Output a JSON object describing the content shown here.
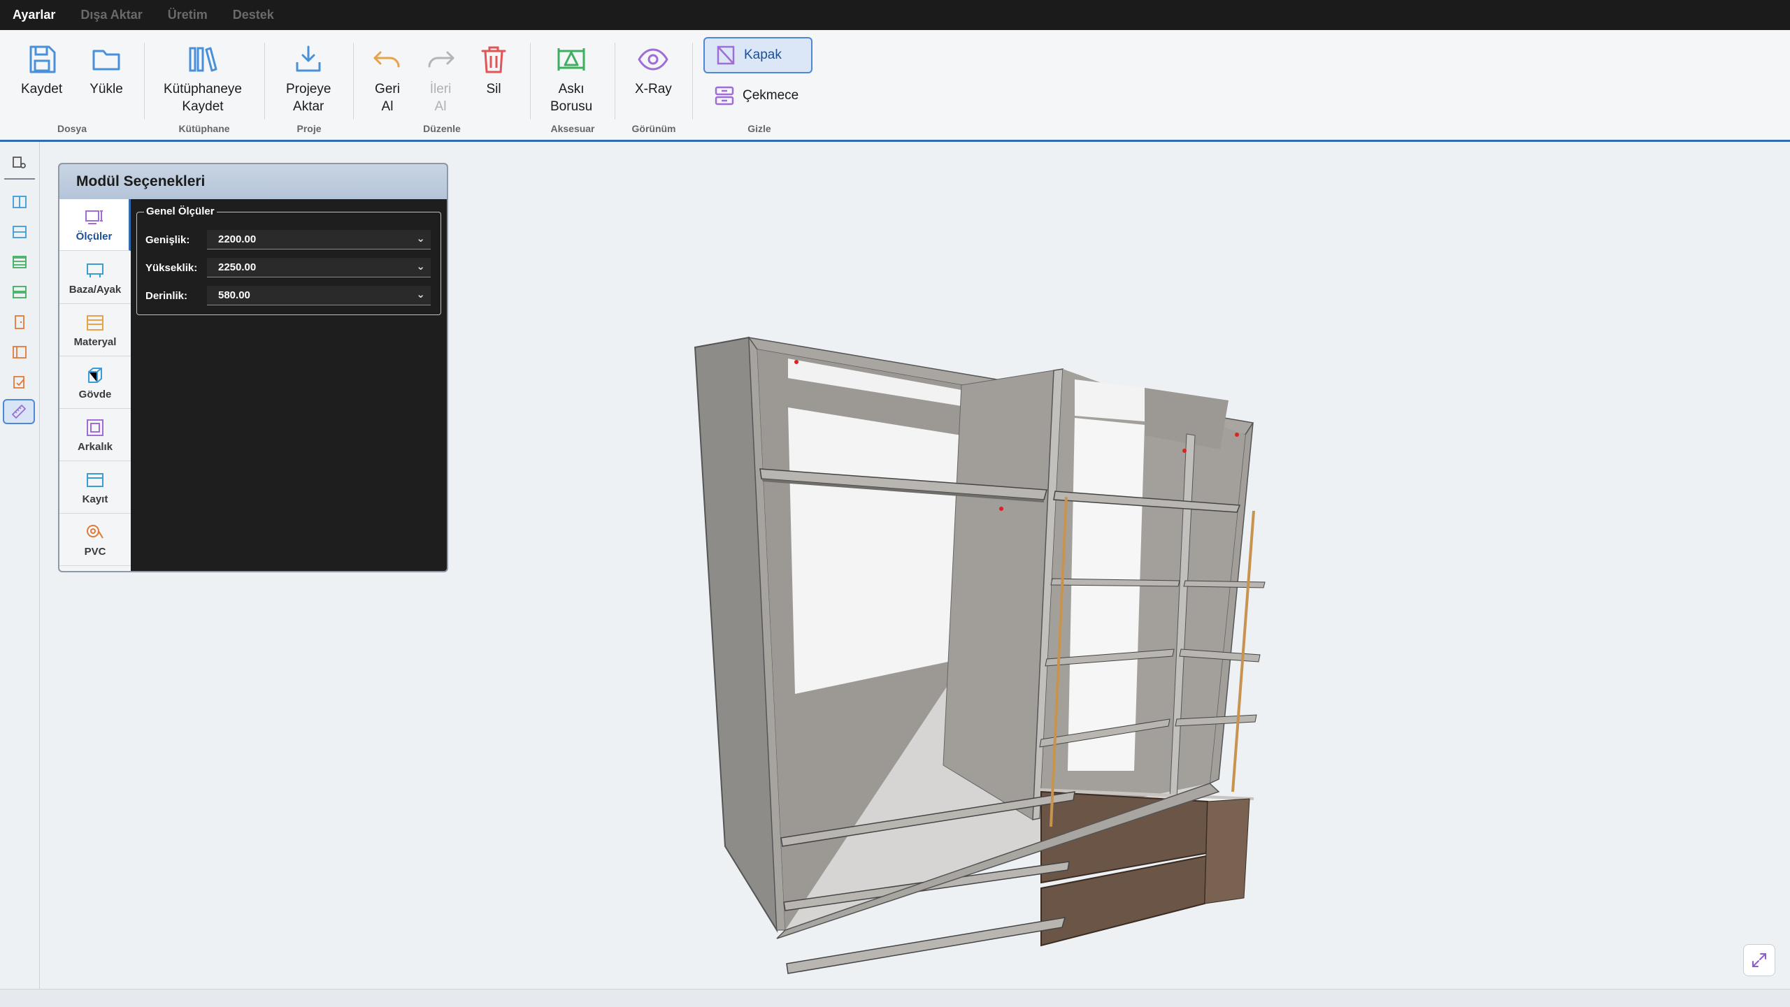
{
  "menu": [
    "Ayarlar",
    "Dışa Aktar",
    "Üretim",
    "Destek"
  ],
  "ribbon": {
    "groups": {
      "dosya": "Dosya",
      "kutuphane": "Kütüphane",
      "proje": "Proje",
      "duzenle": "Düzenle",
      "aksesuar": "Aksesuar",
      "gorunum": "Görünüm",
      "gizle": "Gizle"
    },
    "buttons": {
      "kaydet": "Kaydet",
      "yukle": "Yükle",
      "kutuphaneye_kaydet": "Kütüphaneye\nKaydet",
      "projeye_aktar": "Projeye\nAktar",
      "geri_al": "Geri\nAl",
      "ileri_al": "İleri\nAl",
      "sil": "Sil",
      "aski_borusu": "Askı\nBorusu",
      "xray": "X-Ray",
      "kapak": "Kapak",
      "cekmece": "Çekmece"
    }
  },
  "panel": {
    "title": "Modül Seçenekleri",
    "tabs": [
      "Ölçüler",
      "Baza/Ayak",
      "Materyal",
      "Gövde",
      "Arkalık",
      "Kayıt",
      "PVC"
    ],
    "fieldset_title": "Genel Ölçüler",
    "fields": [
      {
        "label": "Genişlik:",
        "value": "2200.00"
      },
      {
        "label": "Yükseklik:",
        "value": "2250.00"
      },
      {
        "label": "Derinlik:",
        "value": "580.00"
      }
    ]
  },
  "colors": {
    "accent": "#2f6cb5",
    "cabinet": "#9d9a96",
    "drawer": "#6b5546",
    "hanging_rod": "#c8934e"
  }
}
